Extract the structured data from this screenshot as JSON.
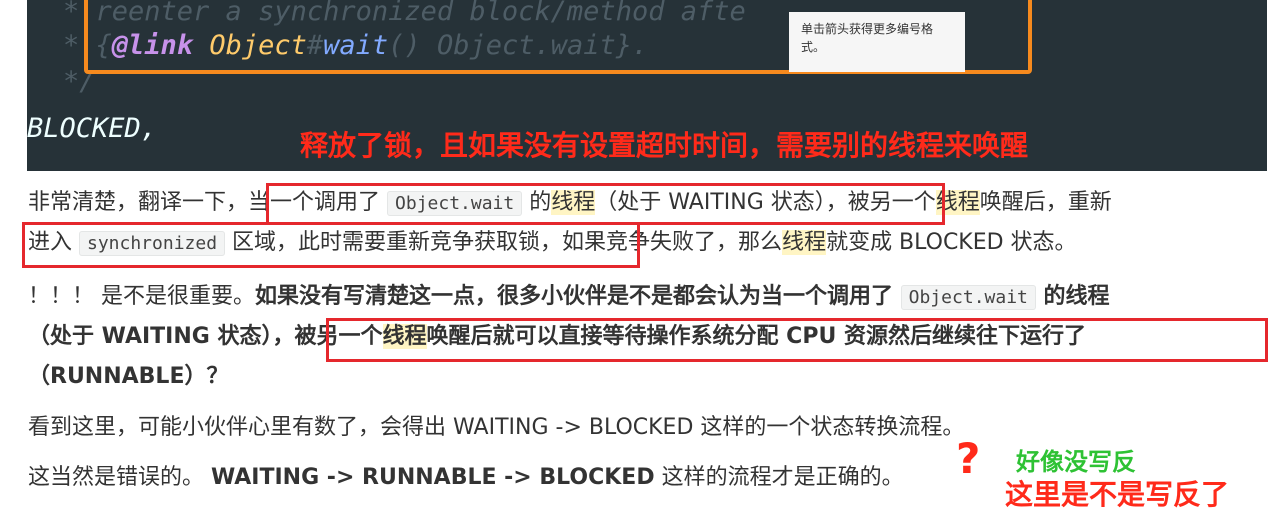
{
  "code": {
    "line1_prefix": "* ",
    "line1_text": "reenter a synchronized block/method afte",
    "line2_prefix": "* ",
    "line2_open": "{",
    "line2_annotation": "@link",
    "line2_class": "Object",
    "line2_hash": "#",
    "line2_method": "wait",
    "line2_rest": "() Object.wait}.",
    "line3_text": "*/",
    "line4_text": "BLOCKED,",
    "highlight_color": "#f68a1e"
  },
  "tooltip": {
    "text": "单击箭头获得更多编号格式。"
  },
  "annotations": {
    "red_top": "释放了锁，且如果没有设置超时时间，需要别的线程来唤醒",
    "question_mark": "?",
    "green_note": "好像没写反",
    "red_bottom": "这里是不是写反了",
    "red_color": "#ff2a1a",
    "green_color": "#2ec234"
  },
  "article": {
    "p1_line1": {
      "a": "非常清楚，翻译一下，",
      "b": "当一个调用了 ",
      "code": "Object.wait",
      "c": " 的",
      "hl1": "线程",
      "d": "（处于 WAITING 状态），被另一个",
      "hl2": "线程",
      "e": "唤醒后，重新"
    },
    "p1_line2": {
      "a": "进入 ",
      "code": "synchronized",
      "b": " 区域，此时需要重新竞争获取锁，如果竞争失败了，那么",
      "hl": "线程",
      "c": "就变成 BLOCKED 状态。"
    },
    "p2_line1": {
      "a": "！！！ 是不是很重要。",
      "b": "如果没有写清楚这一点，很多小伙伴是不是都会认为当一个调用了 ",
      "code": "Object.wait",
      "c": " 的线程"
    },
    "p2_line2": {
      "a": "（处于 WAITING 状态），",
      "b": "被另一个",
      "hl": "线程",
      "c": "唤醒后就可以直接等待操作系统分配 CPU 资源然后继续往下运行了"
    },
    "p2_line3": "（RUNNABLE）？",
    "p3": "看到这里，可能小伙伴心里有数了，会得出 WAITING -> BLOCKED 这样的一个状态转换流程。",
    "p4": {
      "a": "这当然是错误的。 ",
      "b": "WAITING -> RUNNABLE -> BLOCKED",
      "c": " 这样的流程才是正确的。"
    }
  }
}
